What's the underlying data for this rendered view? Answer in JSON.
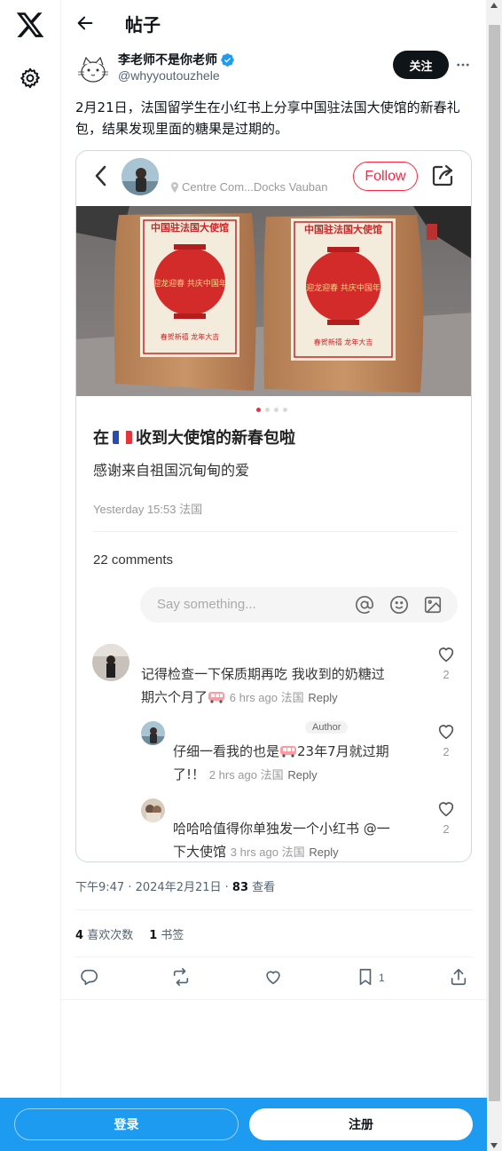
{
  "page": {
    "title": "帖子"
  },
  "author": {
    "name": "李老师不是你老师",
    "handle": "@whyyoutouzhele",
    "follow_label": "关注"
  },
  "tweet": {
    "text": "2月21日，法国留学生在小红书上分享中国驻法国大使馆的新春礼包，结果发现里面的糖果是过期的。",
    "time": "下午9:47",
    "date": "2024年2月21日",
    "views_count": "83",
    "views_label": "查看",
    "likes_count": "4",
    "likes_label": "喜欢次数",
    "bookmarks_count": "1",
    "bookmarks_label": "书签",
    "bookmark_action_count": "1"
  },
  "embed": {
    "location": "Centre Com...Docks Vauban",
    "follow_label": "Follow",
    "bag_label": "中国驻法国大使馆",
    "bag_lantern_text": "迎龙迎春 共庆中国年",
    "bag_footer": "春贺新禧 龙年大吉",
    "post_title_before": "在",
    "post_title_after": "收到大使馆的新春包啦",
    "post_desc": "感谢来自祖国沉甸甸的爱",
    "post_date": "Yesterday 15:53 法国",
    "comments_count": "22 comments",
    "input_placeholder": "Say something...",
    "carousel_total": 4,
    "carousel_index": 0,
    "comments": [
      {
        "text_line1": "记得检查一下保质期再吃 我收到的奶糖过",
        "text_line2": "期六个月了",
        "time": "6 hrs ago 法国",
        "reply": "Reply",
        "likes": "2"
      },
      {
        "badge": "Author",
        "text_line1_a": "仔细一看我的也是",
        "text_line1_b": "23年7月就过期",
        "text_line2": "了!！",
        "time": "2 hrs ago 法国",
        "reply": "Reply",
        "likes": "2"
      },
      {
        "text_line1": "哈哈哈值得你单独发一个小红书 @一",
        "text_line2": "下大使馆",
        "time": "3 hrs ago 法国",
        "reply": "Reply",
        "likes": "2"
      }
    ]
  },
  "bottom": {
    "login_label": "登录",
    "signup_label": "注册"
  },
  "icons": {
    "logo": "x-logo-icon",
    "settings": "gear-icon",
    "back": "arrow-left-icon",
    "verified": "verified-badge-icon",
    "more": "more-horizontal-icon",
    "reply": "reply-icon",
    "retweet": "retweet-icon",
    "like": "heart-icon",
    "bookmark": "bookmark-icon",
    "share": "share-icon"
  },
  "colors": {
    "brand_blue": "#1d9bf0",
    "text_primary": "#0f1419",
    "text_secondary": "#536471",
    "xhs_red": "#ff2442"
  }
}
